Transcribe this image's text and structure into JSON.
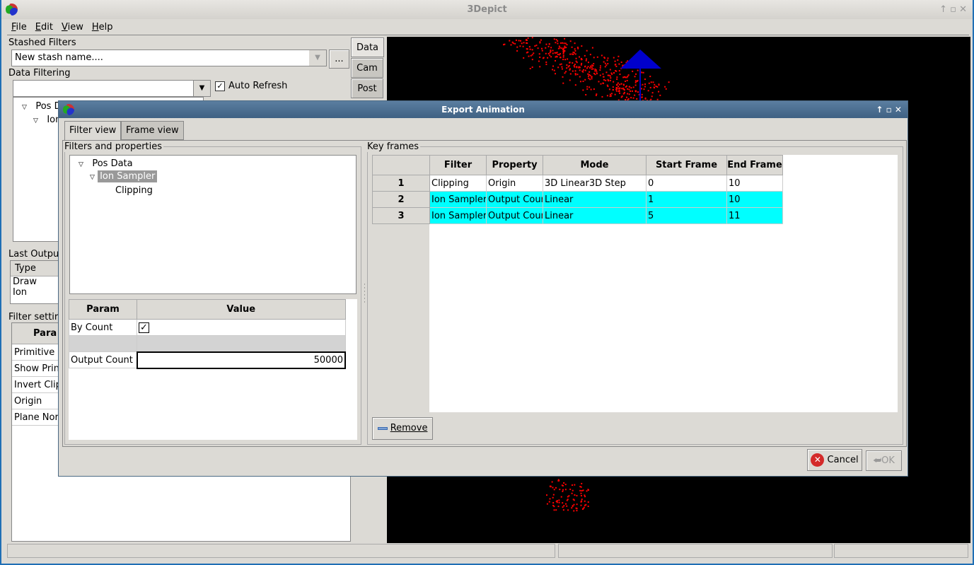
{
  "app": {
    "title": "3Depict"
  },
  "menu": [
    "File",
    "Edit",
    "View",
    "Help"
  ],
  "left": {
    "stashed_label": "Stashed Filters",
    "stash_value": "New stash name....",
    "stash_more": "...",
    "data_filtering_label": "Data Filtering",
    "auto_refresh": "Auto Refresh",
    "auto_refresh_checked": true,
    "tree": [
      "Pos D",
      "Ion"
    ],
    "side_tabs": [
      "Data",
      "Cam",
      "Post"
    ],
    "last_output_label": "Last Outpu",
    "last_output_header": "Type",
    "last_output_rows": [
      "Draw",
      "Ion"
    ],
    "filter_settings_label": "Filter settir",
    "filter_settings_header": "Para",
    "filter_settings_rows": [
      "Primitive",
      "Show Prin",
      "Invert Clip",
      "Origin",
      "Plane Nor"
    ]
  },
  "dialog": {
    "title": "Export Animation",
    "tabs": [
      "Filter view",
      "Frame view"
    ],
    "filters_group": "Filters and properties",
    "tree": [
      "Pos Data",
      "Ion Sampler",
      "Clipping"
    ],
    "param_headers": [
      "Param",
      "Value"
    ],
    "params": [
      {
        "name": "By Count",
        "checked": true
      },
      {
        "name": "",
        "value": ""
      },
      {
        "name": "Output Count",
        "value": "50000"
      }
    ],
    "keyframes_group": "Key frames",
    "kf_headers": [
      "Filter",
      "Property",
      "Mode",
      "Start Frame",
      "End Frame"
    ],
    "kf_rows": [
      {
        "n": "1",
        "filter": "Clipping",
        "property": "Origin",
        "mode": "3D Linear3D Step",
        "start": "0",
        "end": "10",
        "highlight": false
      },
      {
        "n": "2",
        "filter": "Ion Sampler",
        "property": "Output Count",
        "mode": "Linear",
        "start": "1",
        "end": "10",
        "highlight": true
      },
      {
        "n": "3",
        "filter": "Ion Sampler",
        "property": "Output Count",
        "mode": "Linear",
        "start": "5",
        "end": "11",
        "highlight": true
      }
    ],
    "remove": "Remove",
    "cancel": "Cancel",
    "ok": "OK"
  },
  "colors": {
    "highlight": "#00ffff",
    "points": "#ff0000",
    "cone": "#0000cc"
  }
}
